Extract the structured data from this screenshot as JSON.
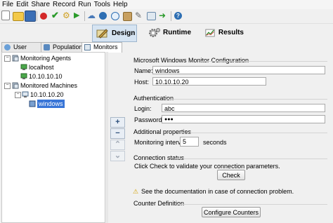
{
  "menu": [
    "File",
    "Edit",
    "Share",
    "Record",
    "Run",
    "Tools",
    "Help"
  ],
  "toolbar": {
    "icons": [
      "new-icon",
      "open-icon",
      "save-icon",
      "record-icon",
      "check-icon",
      "run-icon",
      "play-icon",
      "cloud-icon",
      "browser-icon",
      "target-icon",
      "image-icon",
      "wand-icon",
      "monitor-icon",
      "import-icon",
      "help-icon"
    ]
  },
  "modes": {
    "design": "Design",
    "runtime": "Runtime",
    "results": "Results",
    "active": "design"
  },
  "tabs": [
    {
      "label": "User Paths",
      "icon": "user-paths-icon"
    },
    {
      "label": "Populations",
      "icon": "populations-icon"
    },
    {
      "label": "Monitors",
      "icon": "monitors-icon",
      "selected": true
    }
  ],
  "tree": {
    "agents_label": "Monitoring Agents",
    "agents": [
      "localhost",
      "10.10.10.10"
    ],
    "machines_label": "Monitored Machines",
    "machine": "10.10.10.20",
    "monitor": "windows"
  },
  "side_buttons": {
    "add": "+",
    "remove": "−",
    "up": "⌃",
    "down": "⌄"
  },
  "form": {
    "config_title": "Microsoft Windows Monitor Configuration",
    "name_label": "Name:",
    "name_value": "windows",
    "host_label": "Host:",
    "host_value": "10.10.10.20",
    "auth_title": "Authentication",
    "login_label": "Login:",
    "login_value": "abc",
    "password_label": "Password:",
    "password_value": "●●●",
    "props_title": "Additional properties",
    "interval_label": "Monitoring interval:",
    "interval_value": "5",
    "interval_unit": "seconds",
    "status_title": "Connection status",
    "status_text": "Click Check to validate your connection parameters.",
    "check_button": "Check",
    "warning_text": "See the documentation in case of connection problem.",
    "counter_title": "Counter Definition",
    "configure_button": "Configure Counters"
  },
  "colors": {
    "accent": "#d6e4f2",
    "selection": "#3875d7"
  }
}
